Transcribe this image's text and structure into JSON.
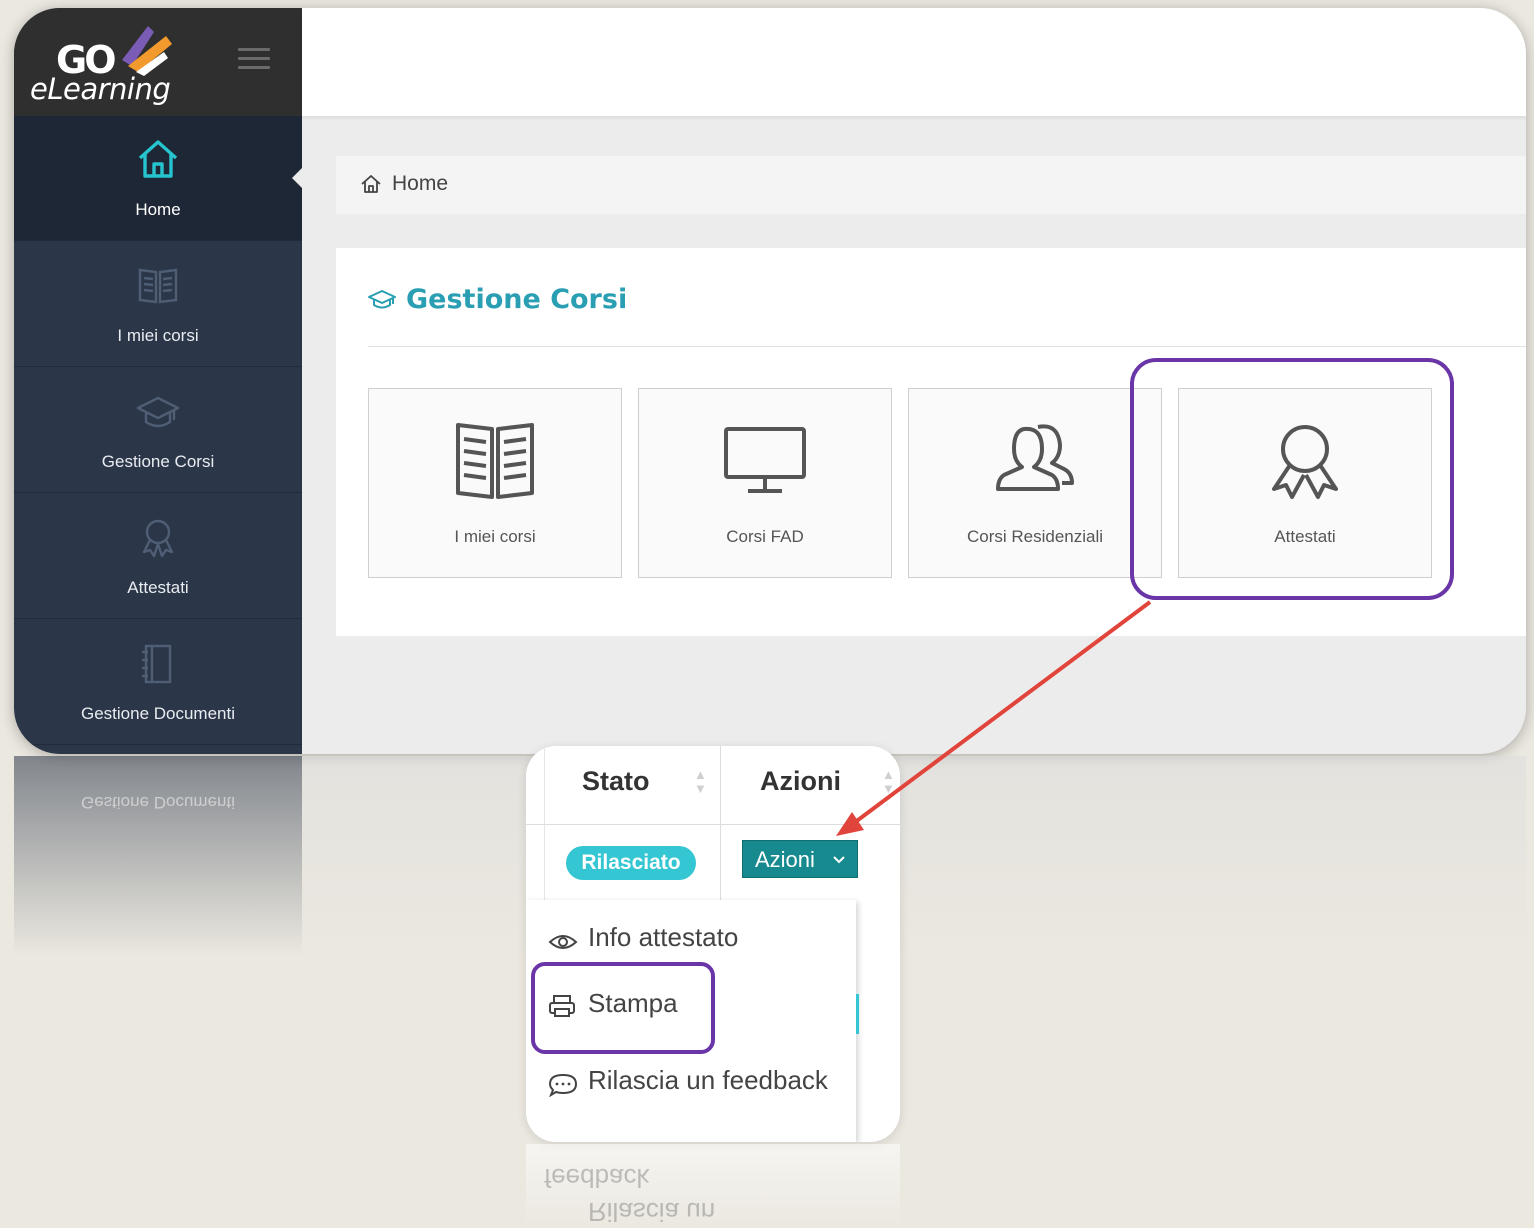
{
  "logo": {
    "go": "GO",
    "elearning": "eLearning"
  },
  "sidebar": {
    "items": [
      {
        "label": "Home",
        "icon": "home-icon"
      },
      {
        "label": "I miei corsi",
        "icon": "book-icon"
      },
      {
        "label": "Gestione Corsi",
        "icon": "graduation-cap-icon"
      },
      {
        "label": "Attestati",
        "icon": "award-icon"
      },
      {
        "label": "Gestione Documenti",
        "icon": "notebook-icon"
      }
    ]
  },
  "breadcrumb": {
    "label": "Home",
    "icon": "home-icon"
  },
  "panel": {
    "title": "Gestione Corsi",
    "tiles": [
      {
        "label": "I miei corsi",
        "icon": "book-icon"
      },
      {
        "label": "Corsi FAD",
        "icon": "monitor-icon"
      },
      {
        "label": "Corsi Residenziali",
        "icon": "users-icon"
      },
      {
        "label": "Attestati",
        "icon": "award-icon"
      }
    ]
  },
  "popup": {
    "columns": [
      "Stato",
      "Azioni"
    ],
    "status_badge": "Rilasciato",
    "actions_button": "Azioni",
    "menu": [
      {
        "label": "Info attestato",
        "icon": "eye-icon"
      },
      {
        "label": "Stampa",
        "icon": "printer-icon"
      },
      {
        "label": "Rilascia un feedback",
        "icon": "comment-icon"
      }
    ]
  },
  "colors": {
    "sidebar": "#2b3648",
    "accent": "#2a9fb3",
    "highlight": "#6a35a7",
    "arrow": "#e0443a",
    "badge": "#35c6d3",
    "button": "#178a8f"
  }
}
